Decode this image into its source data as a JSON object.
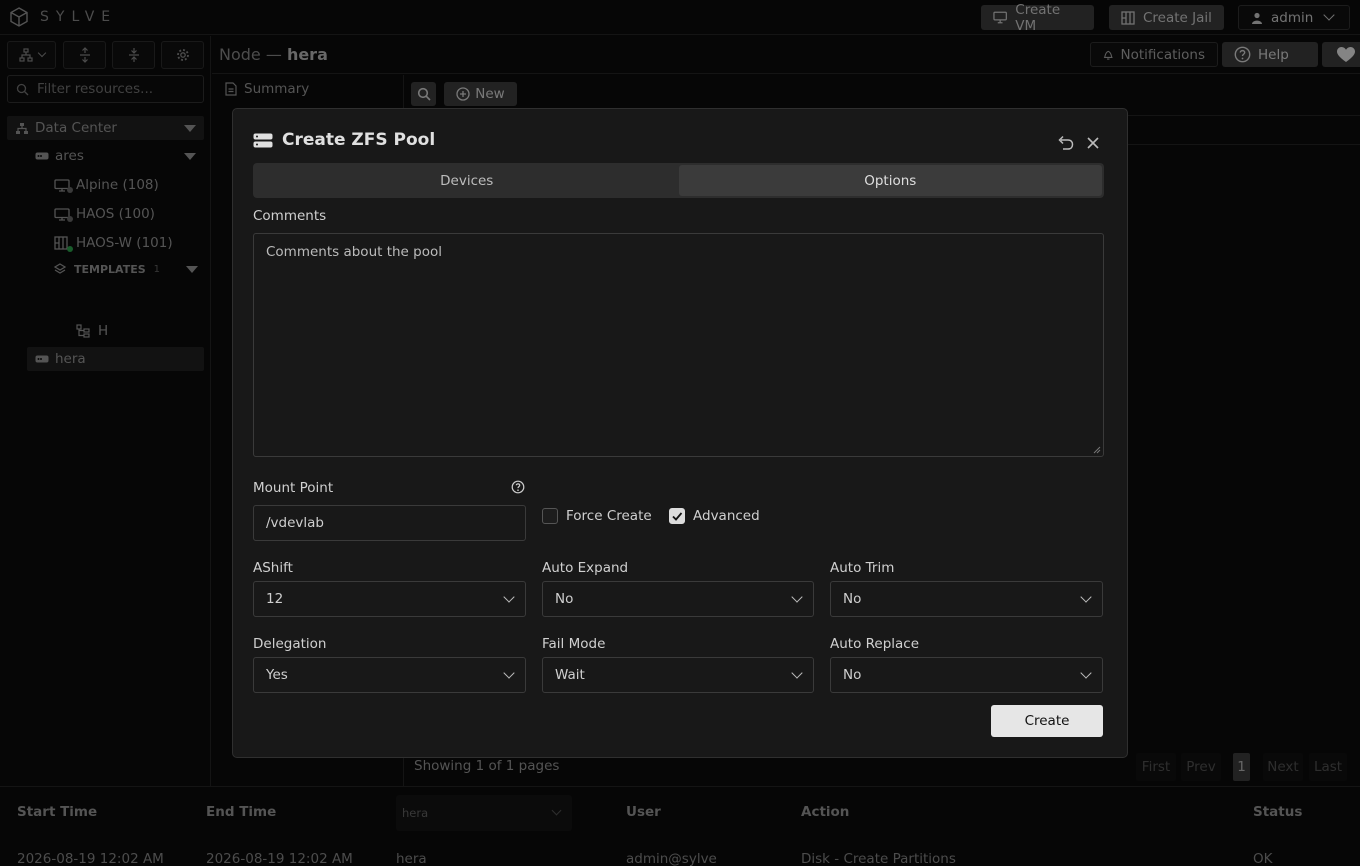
{
  "app": {
    "name": "SYLVE"
  },
  "topbar": {
    "create_vm": "Create VM",
    "create_jail": "Create Jail",
    "user": "admin"
  },
  "sidebar": {
    "filter_placeholder": "Filter resources...",
    "datacenter": "Data Center",
    "nodes": [
      {
        "name": "ares"
      },
      {
        "name": "hera"
      }
    ],
    "items": [
      {
        "label": "Alpine (108)",
        "status_color": "#6a6a6a"
      },
      {
        "label": "HAOS (100)",
        "status_color": "#6a6a6a"
      },
      {
        "label": "HAOS-W (101)",
        "status_color": "#2fa84f"
      }
    ],
    "templates_label": "TEMPLATES",
    "templates_count": "1",
    "template_item": "H"
  },
  "header": {
    "title_prefix": "Node —",
    "title_node": "hera",
    "notifications": "Notifications",
    "help": "Help"
  },
  "side_menu": {
    "summary": "Summary"
  },
  "toolbar": {
    "new": "New"
  },
  "modal": {
    "title": "Create ZFS Pool",
    "tabs": [
      {
        "label": "Devices"
      },
      {
        "label": "Options"
      }
    ],
    "comments_label": "Comments",
    "comments_value": "Comments about the pool",
    "mount_point_label": "Mount Point",
    "mount_point_value": "/vdevlab",
    "force_create_label": "Force Create",
    "force_create_checked": false,
    "advanced_label": "Advanced",
    "advanced_checked": true,
    "fields": {
      "ashift": {
        "label": "AShift",
        "value": "12"
      },
      "auto_expand": {
        "label": "Auto Expand",
        "value": "No"
      },
      "auto_trim": {
        "label": "Auto Trim",
        "value": "No"
      },
      "delegation": {
        "label": "Delegation",
        "value": "Yes"
      },
      "fail_mode": {
        "label": "Fail Mode",
        "value": "Wait"
      },
      "auto_replace": {
        "label": "Auto Replace",
        "value": "No"
      }
    },
    "create_label": "Create"
  },
  "pagination": {
    "showing": "Showing 1 of 1 pages",
    "first": "First",
    "prev": "Prev",
    "page": "1",
    "next": "Next",
    "last": "Last"
  },
  "tasks": {
    "headers": {
      "start": "Start Time",
      "end": "End Time",
      "node_filter": "hera",
      "user": "User",
      "action": "Action",
      "status": "Status"
    },
    "rows": [
      {
        "start": "2026-08-19 12:02 AM",
        "end": "2026-08-19 12:02 AM",
        "node": "hera",
        "user": "admin@sylve",
        "action": "Disk - Create Partitions",
        "status": "OK"
      }
    ]
  }
}
